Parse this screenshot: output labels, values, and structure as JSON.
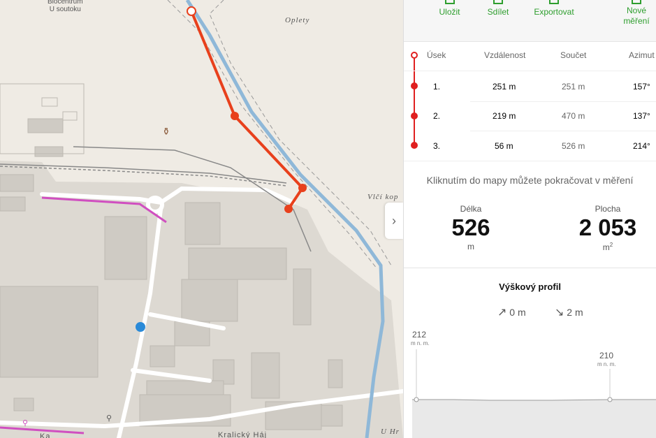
{
  "map": {
    "labels": {
      "oplety": "Oplety",
      "vlci": "Vlčí kop",
      "uhr": "U Hr",
      "kralicky": "Kralický Háj",
      "ka": "Ka"
    },
    "poi": {
      "line1": "Biocentrum",
      "line2": "U soutoku"
    },
    "route_color": "#e8401c",
    "river_color": "#8fb8d8"
  },
  "toolbar": {
    "save": "Uložit",
    "share": "Sdílet",
    "export": "Exportovat",
    "new_line1": "Nové",
    "new_line2": "měření"
  },
  "table": {
    "headers": {
      "segment": "Úsek",
      "distance": "Vzdálenost",
      "sum": "Součet",
      "azimuth": "Azimut"
    },
    "rows": [
      {
        "n": "1.",
        "dist": "251 m",
        "sum": "251 m",
        "az": "157°"
      },
      {
        "n": "2.",
        "dist": "219 m",
        "sum": "470 m",
        "az": "137°"
      },
      {
        "n": "3.",
        "dist": "56 m",
        "sum": "526 m",
        "az": "214°"
      }
    ]
  },
  "hint": "Kliknutím do mapy můžete pokračovat v měření",
  "length": {
    "label": "Délka",
    "value": "526",
    "unit": "m"
  },
  "area": {
    "label": "Plocha",
    "value": "2 053",
    "unit": "m",
    "sup": "2"
  },
  "profile": {
    "title": "Výškový profil",
    "ascent": "0 m",
    "descent": "2 m",
    "max_label": "212",
    "min_label": "210",
    "unit_label": "m n. m."
  },
  "colors": {
    "accent": "#2e9e2e",
    "route": "#e02020"
  },
  "icons": {
    "collapse": "chevron-right-icon",
    "up": "arrow-up-right-icon",
    "down": "arrow-down-right-icon"
  }
}
